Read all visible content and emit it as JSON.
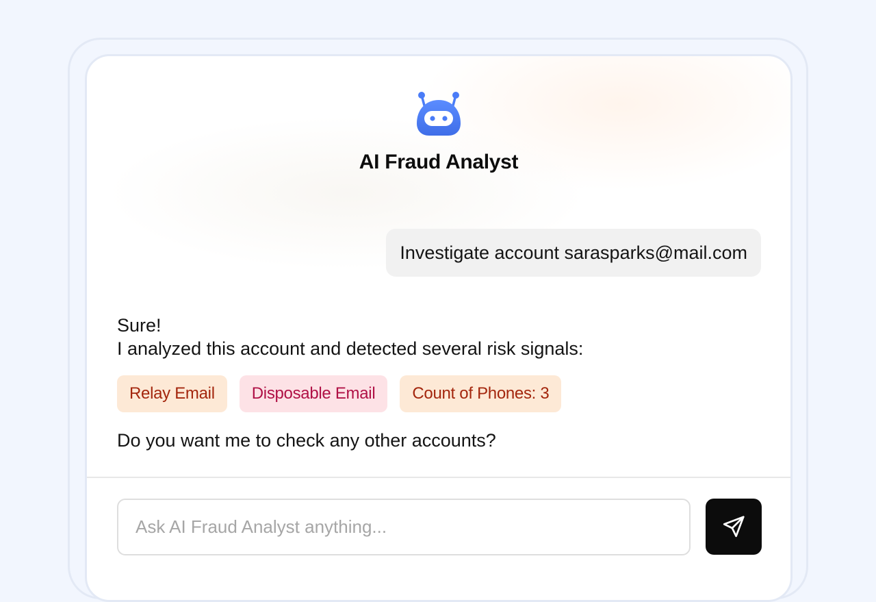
{
  "header": {
    "icon": "robot-icon",
    "title": "AI Fraud Analyst"
  },
  "conversation": {
    "user_message": "Investigate account sarasparks@mail.com",
    "ai_reply": {
      "line1": "Sure!",
      "line2": "I analyzed this account and detected several risk signals:",
      "tags": [
        {
          "label": "Relay Email",
          "color": "#a3260d",
          "background": "#fde9d6"
        },
        {
          "label": "Disposable Email",
          "color": "#b01146",
          "background": "#fde2e6"
        },
        {
          "label": "Count of Phones: 3",
          "color": "#a3260d",
          "background": "#fde9d6"
        }
      ],
      "followup": "Do you want me to check any other accounts?"
    }
  },
  "composer": {
    "placeholder": "Ask AI Fraud Analyst anything...",
    "value": "",
    "send_icon": "send-icon"
  },
  "colors": {
    "accent": "#4a7cf7",
    "send_button": "#0c0c0c"
  }
}
